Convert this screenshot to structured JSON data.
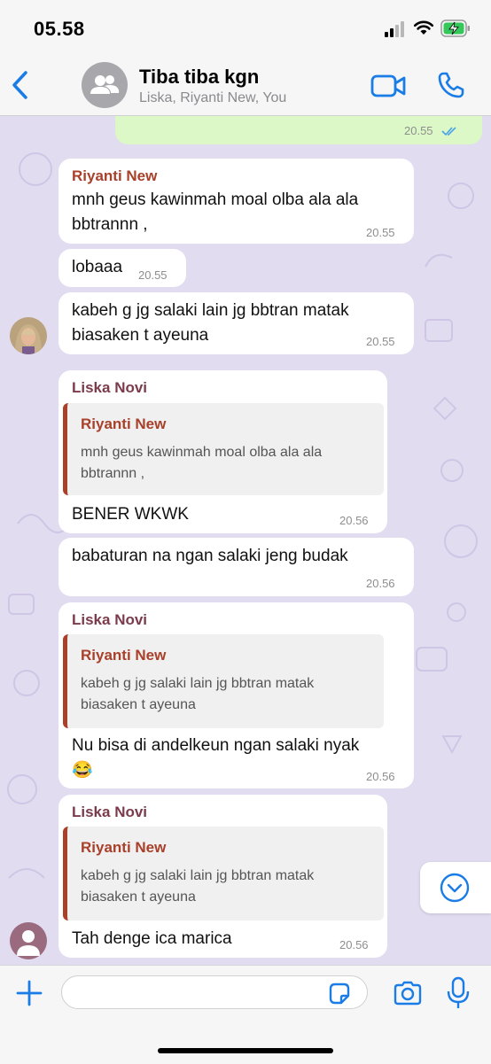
{
  "status_bar": {
    "time": "05.58"
  },
  "header": {
    "title": "Tiba tiba kgn",
    "subtitle": "Liska, Riyanti New, You"
  },
  "colors": {
    "accent": "#1a7ce6",
    "outgoing_bubble": "#dcf8c6",
    "sender_liska": "#7b3b4b",
    "sender_riyanti": "#a8402a",
    "chat_background": "#e2dcf0"
  },
  "messages": [
    {
      "type": "outgoing",
      "time": "20.55",
      "status": "read-double-check-icon"
    },
    {
      "type": "incoming",
      "sender": "Riyanti New",
      "lines": [
        "mnh geus kawinmah moal olba ala ala",
        "bbtrannn ,"
      ],
      "time": "20.55"
    },
    {
      "type": "incoming",
      "text": "lobaaa",
      "time": "20.55"
    },
    {
      "type": "incoming",
      "lines": [
        "kabeh g jg salaki lain jg bbtran matak",
        "biasaken t ayeuna"
      ],
      "time": "20.55"
    },
    {
      "type": "incoming",
      "sender": "Liska Novi",
      "quote": {
        "sender": "Riyanti New",
        "lines": [
          "mnh geus kawinmah moal olba ala ala",
          "bbtrannn ,"
        ]
      },
      "text": "BENER WKWK",
      "time": "20.56"
    },
    {
      "type": "incoming",
      "text": "babaturan na ngan salaki jeng budak",
      "time": "20.56"
    },
    {
      "type": "incoming",
      "sender": "Liska Novi",
      "quote": {
        "sender": "Riyanti New",
        "lines": [
          "kabeh g jg salaki lain jg bbtran matak",
          "biasaken t ayeuna"
        ]
      },
      "lines": [
        "Nu bisa di andelkeun ngan salaki nyak",
        "😂"
      ],
      "time": "20.56"
    },
    {
      "type": "incoming",
      "sender": "Liska Novi",
      "quote": {
        "sender": "Riyanti New",
        "lines": [
          "kabeh g jg salaki lain jg bbtran matak",
          "biasaken t ayeuna"
        ]
      },
      "text": "Tah denge ica marica",
      "time": "20.56"
    }
  ],
  "input": {
    "value": "",
    "placeholder": ""
  },
  "icons": {
    "back": "chevron-left-icon",
    "group": "group-avatar-icon",
    "video": "video-call-icon",
    "phone": "phone-call-icon",
    "plus": "plus-icon",
    "sticker": "sticker-icon",
    "camera": "camera-icon",
    "mic": "microphone-icon",
    "scroll": "scroll-down-icon"
  }
}
